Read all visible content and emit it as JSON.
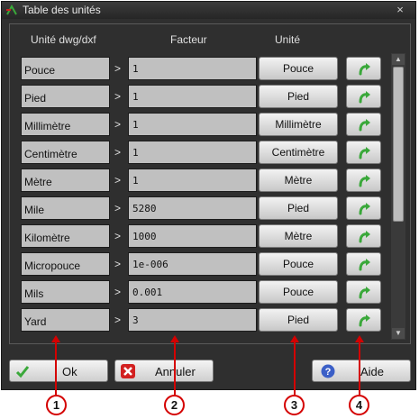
{
  "window": {
    "title": "Table des unités",
    "close_label": "×"
  },
  "headers": {
    "dwg": "Unité dwg/dxf",
    "factor": "Facteur",
    "unit": "Unité"
  },
  "separator": ">",
  "rows": [
    {
      "name": "Pouce",
      "factor": "1",
      "unit": "Pouce"
    },
    {
      "name": "Pied",
      "factor": "1",
      "unit": "Pied"
    },
    {
      "name": "Millimètre",
      "factor": "1",
      "unit": "Millimètre"
    },
    {
      "name": "Centimètre",
      "factor": "1",
      "unit": "Centimètre"
    },
    {
      "name": "Mètre",
      "factor": "1",
      "unit": "Mètre"
    },
    {
      "name": "Mile",
      "factor": "5280",
      "unit": "Pied"
    },
    {
      "name": "Kilomètre",
      "factor": "1000",
      "unit": "Mètre"
    },
    {
      "name": "Micropouce",
      "factor": "1e-006",
      "unit": "Pouce"
    },
    {
      "name": "Mils",
      "factor": "0.001",
      "unit": "Pouce"
    },
    {
      "name": "Yard",
      "factor": "3",
      "unit": "Pied"
    }
  ],
  "buttons": {
    "ok": "Ok",
    "cancel": "Annuler",
    "help": "Aide"
  },
  "callouts": [
    "1",
    "2",
    "3",
    "4"
  ],
  "colors": {
    "accent_green": "#3aa83a",
    "callout_red": "#d40000"
  }
}
